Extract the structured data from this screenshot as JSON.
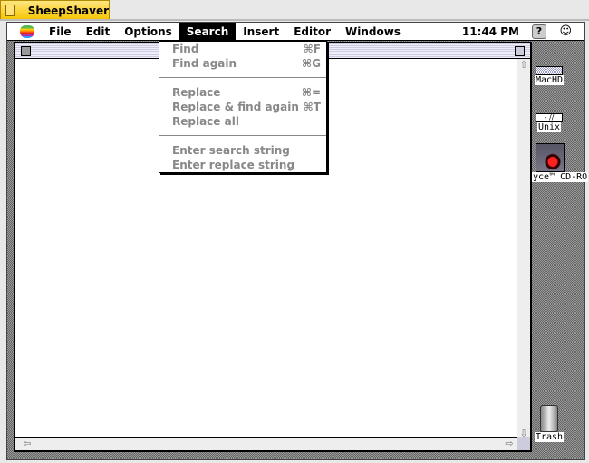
{
  "host": {
    "title": "SheepShaver"
  },
  "menubar": {
    "items": [
      "File",
      "Edit",
      "Options",
      "Search",
      "Insert",
      "Editor",
      "Windows"
    ],
    "active": "Search",
    "clock": "11:44 PM"
  },
  "search_menu": {
    "group1": [
      {
        "label": "Find",
        "shortcut": "⌘F"
      },
      {
        "label": "Find again",
        "shortcut": "⌘G"
      }
    ],
    "group2": [
      {
        "label": "Replace",
        "shortcut": "⌘="
      },
      {
        "label": "Replace & find again",
        "shortcut": "⌘T"
      },
      {
        "label": "Replace all",
        "shortcut": ""
      }
    ],
    "group3": [
      {
        "label": "Enter search string"
      },
      {
        "label": "Enter replace string"
      }
    ]
  },
  "desktop": {
    "icons": [
      {
        "label": "MacHD"
      },
      {
        "label": "Unix"
      },
      {
        "label": "yce™ CD-RO"
      },
      {
        "label": "Trash"
      }
    ]
  },
  "colors": {
    "host_tab": "#f5c400",
    "menu_highlight": "#000000",
    "disabled_text": "#888888"
  }
}
